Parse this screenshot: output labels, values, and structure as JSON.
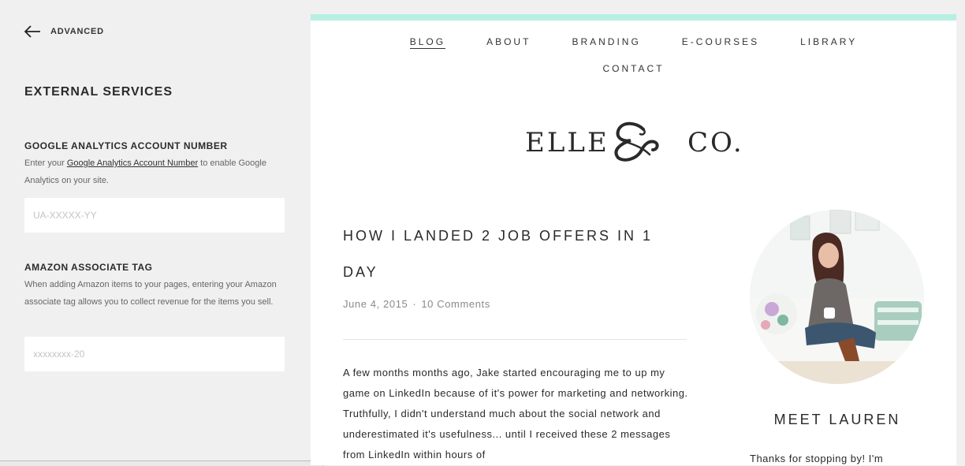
{
  "panel": {
    "back_label": "ADVANCED",
    "section_title": "EXTERNAL SERVICES",
    "google": {
      "label": "GOOGLE ANALYTICS ACCOUNT NUMBER",
      "desc_before": "Enter your ",
      "desc_link": "Google Analytics Account Number",
      "desc_after": " to enable Google Analytics on your site.",
      "placeholder": "UA-XXXXX-YY",
      "value": ""
    },
    "amazon": {
      "label": "AMAZON ASSOCIATE TAG",
      "desc": "When adding Amazon items to your pages, entering your Amazon associate tag allows you to collect revenue for the items you sell.",
      "placeholder": "xxxxxxxx-20",
      "value": ""
    }
  },
  "preview": {
    "accent_color": "#b7efe3",
    "nav": {
      "blog": "BLOG",
      "about": "ABOUT",
      "branding": "BRANDING",
      "ecourses": "E-COURSES",
      "library": "LIBRARY",
      "contact": "CONTACT"
    },
    "logo": {
      "left": "ELLE",
      "right": "CO."
    },
    "post": {
      "title": "HOW I LANDED 2 JOB OFFERS IN 1 DAY",
      "date": "June 4, 2015",
      "separator": "·",
      "comments": "10 Comments",
      "body": "A few months months ago, Jake started encouraging me to up my game on LinkedIn because of it's power for marketing and networking. Truthfully, I didn't understand much about the social network and underestimated it's usefulness... until I received these 2 messages from LinkedIn within hours of"
    },
    "sidebar": {
      "title": "MEET LAUREN",
      "text": "Thanks for stopping by! I'm"
    }
  }
}
